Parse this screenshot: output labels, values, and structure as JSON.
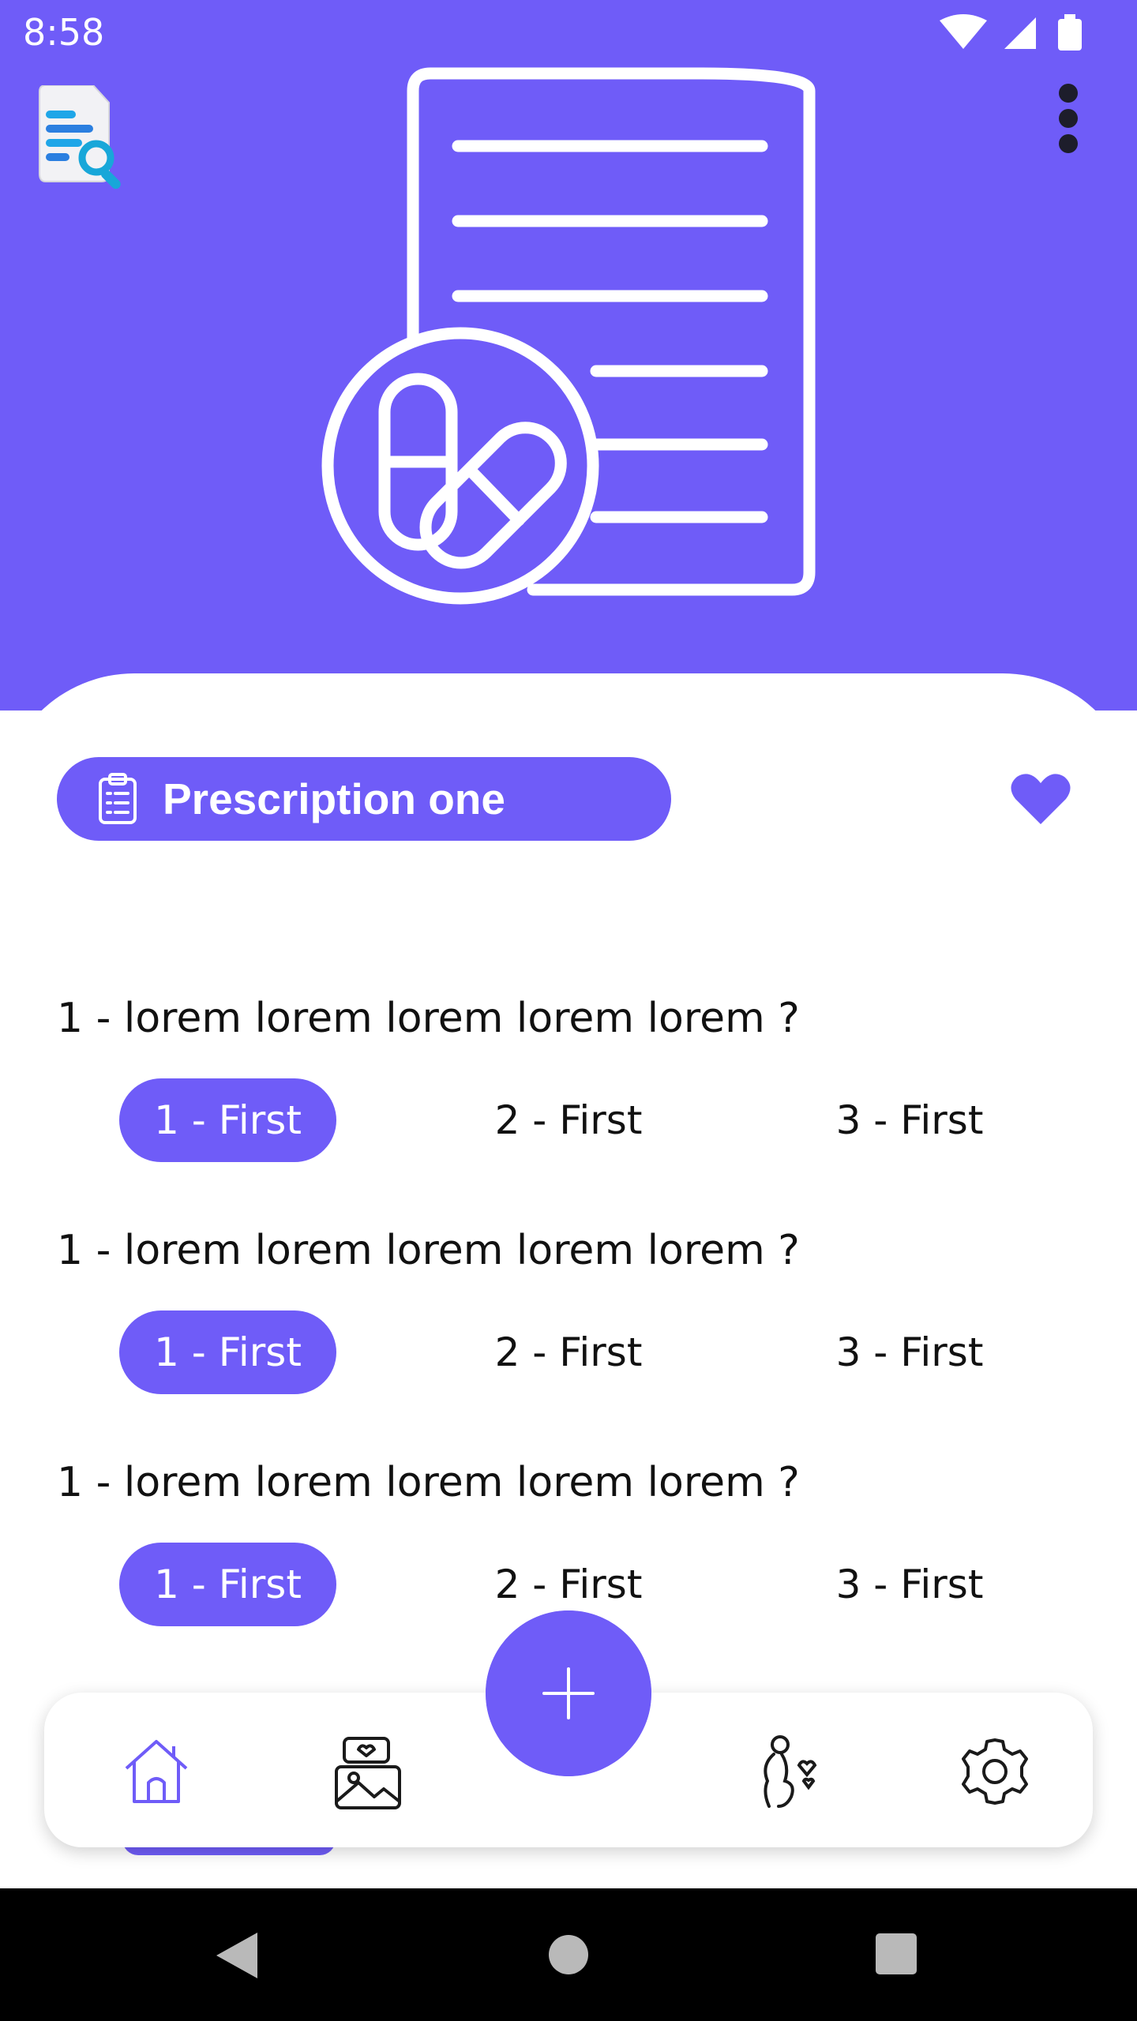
{
  "status_bar": {
    "time": "8:58"
  },
  "colors": {
    "accent": "#6f5cf8",
    "background": "#ffffff",
    "text": "#111111"
  },
  "header": {
    "logo_icon": "document-search-icon",
    "menu_icon": "more-vertical-icon",
    "illustration": "prescription-pills-icon"
  },
  "prescription": {
    "title": "Prescription one",
    "icon": "clipboard-icon",
    "favorite_icon": "heart-icon"
  },
  "questions": [
    {
      "text": "1 - lorem lorem lorem lorem lorem ?",
      "options": [
        "1 - First",
        "2 - First",
        "3 - First"
      ],
      "selected": 0
    },
    {
      "text": "1 - lorem lorem lorem lorem lorem ?",
      "options": [
        "1 - First",
        "2 - First",
        "3 - First"
      ],
      "selected": 0
    },
    {
      "text": "1 - lorem lorem lorem lorem lorem ?",
      "options": [
        "1 - First",
        "2 - First",
        "3 - First"
      ],
      "selected": 0
    }
  ],
  "bottom_nav": {
    "items": [
      "home-icon",
      "gallery-icon",
      "add-icon",
      "pregnancy-icon",
      "settings-icon"
    ],
    "active": "home-icon"
  },
  "system_nav": [
    "back-icon",
    "home-circle-icon",
    "recents-icon"
  ]
}
